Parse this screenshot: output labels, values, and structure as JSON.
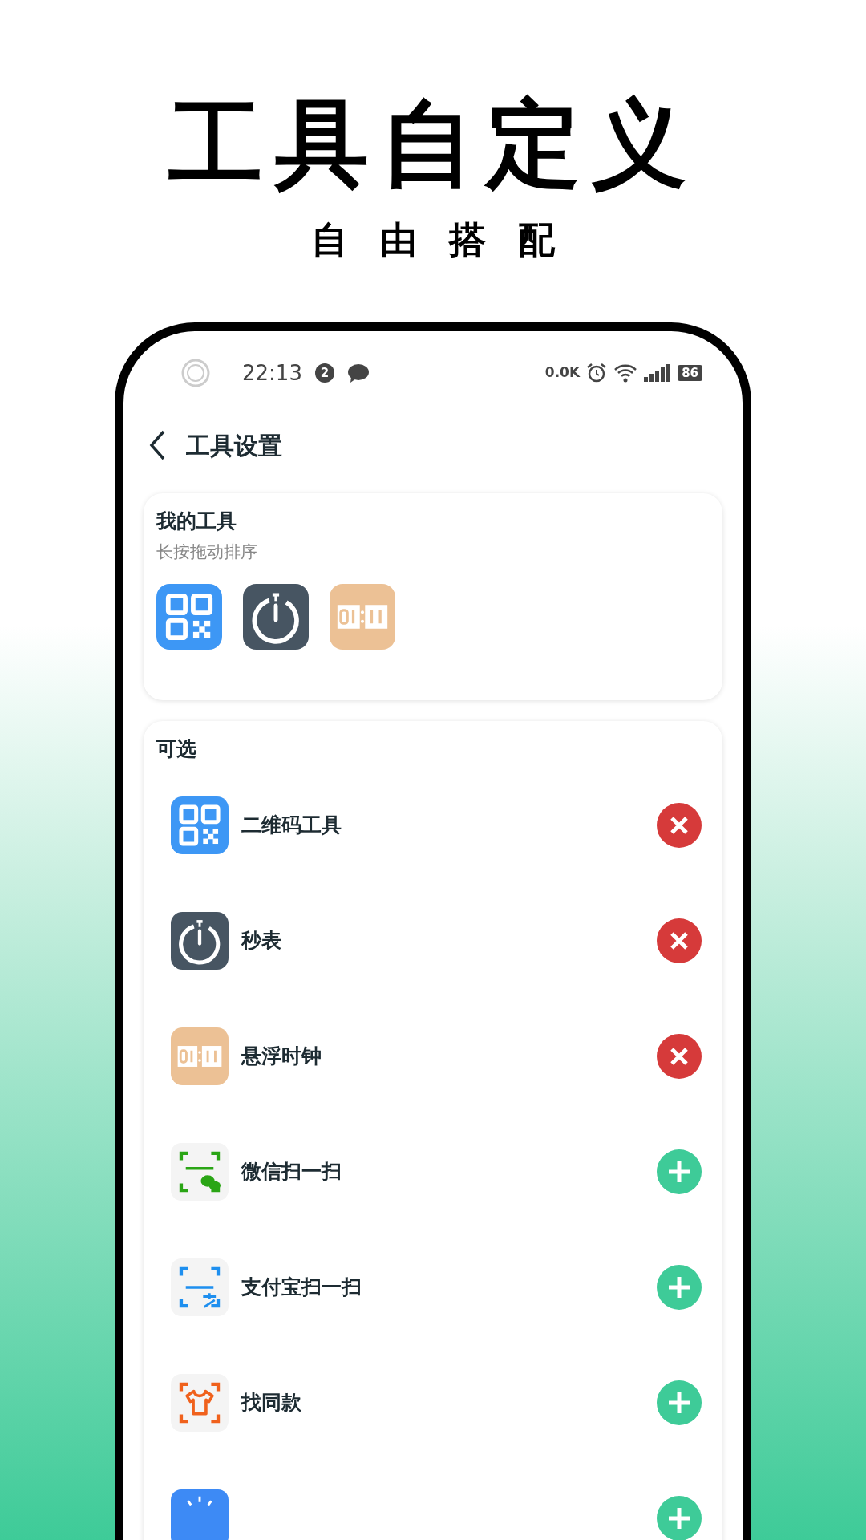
{
  "headline": {
    "title": "工具自定义",
    "subtitle": "自由搭配"
  },
  "status_bar": {
    "time": "22:13",
    "notification_count": "2",
    "net_speed": "0.0K",
    "battery": "86"
  },
  "header": {
    "title": "工具设置"
  },
  "my_tools": {
    "title": "我的工具",
    "hint": "长按拖动排序",
    "tools": [
      {
        "kind": "qr"
      },
      {
        "kind": "stopwatch"
      },
      {
        "kind": "flipclock"
      }
    ]
  },
  "optional": {
    "title": "可选",
    "items": [
      {
        "kind": "qr",
        "label": "二维码工具",
        "added": true
      },
      {
        "kind": "stopwatch",
        "label": "秒表",
        "added": true
      },
      {
        "kind": "flipclock",
        "label": "悬浮时钟",
        "added": true
      },
      {
        "kind": "wechat",
        "label": "微信扫一扫",
        "added": false
      },
      {
        "kind": "alipay",
        "label": "支付宝扫一扫",
        "added": false
      },
      {
        "kind": "shirt",
        "label": "找同款",
        "added": false
      },
      {
        "kind": "bulb",
        "added": false
      }
    ]
  }
}
